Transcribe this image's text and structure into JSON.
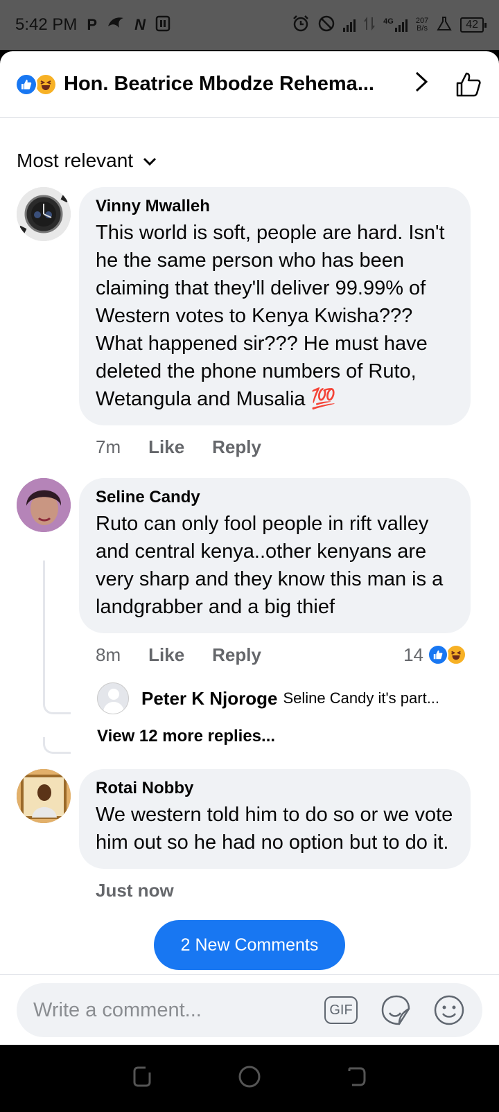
{
  "status_bar": {
    "time": "5:42 PM",
    "app_icons": [
      "P",
      "N"
    ],
    "network": "4G",
    "speed_value": "207",
    "speed_unit": "B/s",
    "battery": "42"
  },
  "header": {
    "title": "Hon. Beatrice Mbodze Rehema...",
    "reactions": [
      "like-reaction-icon",
      "haha-reaction-icon"
    ]
  },
  "sort": {
    "label": "Most relevant"
  },
  "comments": [
    {
      "name": "Vinny Mwalleh",
      "text": "This world is soft, people are hard. Isn't he the same person who has been claiming that they'll deliver 99.99% of Western votes to Kenya Kwisha??? What happened sir??? He must have deleted the phone numbers of Ruto, Wetangula and Musalia 💯",
      "time": "7m",
      "like": "Like",
      "reply": "Reply"
    },
    {
      "name": "Seline Candy",
      "text": "Ruto can only fool people in rift valley and central kenya..other kenyans are very sharp and they know this man is a landgrabber and a big thief",
      "time": "8m",
      "like": "Like",
      "reply": "Reply",
      "reaction_count": "14",
      "reply_preview": {
        "name": "Peter K Njoroge",
        "text": "Seline Candy it's part..."
      },
      "view_more": "View 12 more replies..."
    },
    {
      "name": "Rotai Nobby",
      "text": "We western told him to do so or we vote him out so he had no option but to do it.",
      "time": "Just now"
    }
  ],
  "new_comments_button": "2 New Comments",
  "composer": {
    "placeholder": "Write a comment...",
    "gif_label": "GIF"
  },
  "colors": {
    "accent": "#1877f2",
    "bubble": "#f0f2f5",
    "meta_text": "#65676b",
    "haha": "#f7b125"
  }
}
